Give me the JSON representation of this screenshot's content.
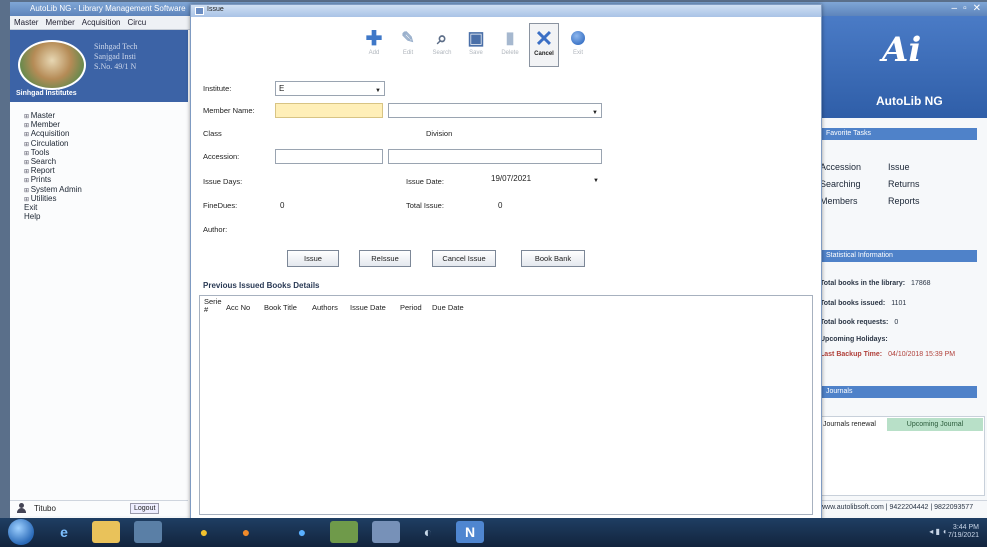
{
  "app": {
    "title": "AutoLib NG - Library Management Software",
    "menus": [
      "Master",
      "Member",
      "Acquisition",
      "Circu"
    ],
    "controls": [
      "–",
      "▫",
      "✕"
    ]
  },
  "left_panel": {
    "school_name": "Sinhgad Tech\nSanjgad Insti\nS.No. 49/1 N",
    "school_caption": "Sinhgad Institutes",
    "nav": [
      {
        "label": "Master",
        "expandable": true
      },
      {
        "label": "Member",
        "expandable": true
      },
      {
        "label": "Acquisition",
        "expandable": true
      },
      {
        "label": "Circulation",
        "expandable": true
      },
      {
        "label": "Tools",
        "expandable": true
      },
      {
        "label": "Search",
        "expandable": true
      },
      {
        "label": "Report",
        "expandable": true
      },
      {
        "label": "Prints",
        "expandable": true
      },
      {
        "label": "System Admin",
        "expandable": true
      },
      {
        "label": "Utilities",
        "expandable": true
      },
      {
        "label": "Exit",
        "expandable": false
      },
      {
        "label": "Help",
        "expandable": false
      }
    ],
    "user_name": "Titubo",
    "logout_label": "Logout"
  },
  "dialog": {
    "title": "Issue",
    "toolbar": [
      {
        "name": "add",
        "label": "Add",
        "glyph": "✚",
        "enabled": true
      },
      {
        "name": "edit",
        "label": "Edit",
        "glyph": "✎",
        "enabled": false
      },
      {
        "name": "search",
        "label": "Search",
        "glyph": "🔍",
        "enabled": true
      },
      {
        "name": "save",
        "label": "Save",
        "glyph": "💾",
        "enabled": true
      },
      {
        "name": "delete",
        "label": "Delete",
        "glyph": "🗑",
        "enabled": false
      },
      {
        "name": "cancel",
        "label": "Cancel",
        "glyph": "✕",
        "enabled": true,
        "active": true
      },
      {
        "name": "exit",
        "label": "Exit",
        "glyph": "",
        "enabled": true
      }
    ],
    "form": {
      "institute_label": "Institute:",
      "institute_value": "E",
      "member_name_label": "Member Name:",
      "member_name_value": "",
      "member_select_value": "",
      "class_label": "Class",
      "division_label": "Division",
      "accession_label": "Accession:",
      "accession_value": "",
      "accession_title_value": "",
      "issue_days_label": "Issue Days:",
      "issue_date_label": "Issue Date:",
      "issue_date_value": "19/07/2021",
      "fine_dues_label": "FineDues:",
      "fine_dues_value": "0",
      "total_issue_label": "Total Issue:",
      "total_issue_value": "0",
      "author_label": "Author:"
    },
    "buttons": {
      "issue": "Issue",
      "reissue": "ReIssue",
      "cancel_issue": "Cancel Issue",
      "book_bank": "Book Bank"
    },
    "previous_title": "Previous Issued Books Details",
    "grid_columns": [
      "Serie\n#",
      "Acc No",
      "Book Title",
      "Authors",
      "Issue Date",
      "Period",
      "Due Date"
    ]
  },
  "right_panel": {
    "product": "AutoLib NG",
    "quick_links_title": "Favorite Tasks",
    "quick_links": [
      "Accession",
      "Issue",
      "Searching",
      "Returns",
      "Members",
      "Reports"
    ],
    "stats_title": "Statistical Information",
    "stats": [
      {
        "label": "Total books in the library:",
        "value": "17868"
      },
      {
        "label": "Total books issued:",
        "value": "1101"
      },
      {
        "label": "Total book requests:",
        "value": "0"
      },
      {
        "label": "Upcoming Holidays:",
        "value": ""
      },
      {
        "label": "Last Backup Time:",
        "value": "04/10/2018 15:39 PM"
      }
    ],
    "journals_title": "Journals",
    "journal_renewal_label": "Journals renewal",
    "upcoming_journal_label": "Upcoming Journal",
    "footer": "www.autolibsoft.com | 9422204442 | 9822093577"
  },
  "taskbar": {
    "icons": [
      "ie-icon",
      "explorer-icon",
      "app-icon",
      "chrome-icon",
      "firefox-icon",
      "edge-icon",
      "word-icon",
      "window-icon",
      "media-icon",
      "autolib-icon"
    ],
    "time": "3:44 PM",
    "date": "7/19/2021"
  }
}
